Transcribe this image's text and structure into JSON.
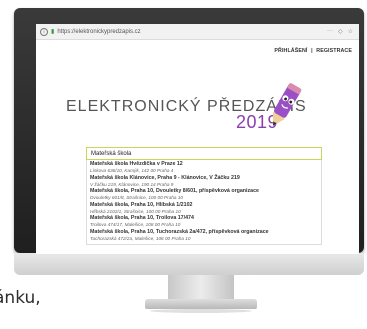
{
  "backdrop": {
    "caption": "ánku,"
  },
  "browser": {
    "url": "https://elektronickypredzapis.cz",
    "menu_glyph": "···",
    "shield_glyph": "◇",
    "star_glyph": "☆"
  },
  "header": {
    "login": "PŘIHLÁŠENÍ",
    "separator": "|",
    "register": "REGISTRACE"
  },
  "logo": {
    "text": "ELEKTRONICKÝ PŘEDZÁPIS",
    "year": "2019",
    "year_color": "#8a3fb0"
  },
  "search": {
    "value": "Mateřská škola"
  },
  "suggestions": [
    {
      "name": "Mateřská škola Hvězdička v Praze 12",
      "address": "Lískova 636/10, Kamýk, 142 00 Praha 4"
    },
    {
      "name": "Mateřská škola Klánovice, Praha 9 - Klánovice, V Žáčku 219",
      "address": "V žáčku 219, Klánovice, 190 14 Praha 9"
    },
    {
      "name": "Mateřská škola, Praha 10, Dvouletky 8/601, příspěvková organizace",
      "address": "Dvouletky 601/8, Strašnice, 100 00 Praha 10"
    },
    {
      "name": "Mateřská škola, Praha 10, Hlíbská 1/2102",
      "address": "Hlíbská 2102/1, Strašnice, 100 00 Praha 10"
    },
    {
      "name": "Mateřská škola, Praha 10, Troilova 17/474",
      "address": "Troilova 474/17, Malešice, 108 00 Praha 10"
    },
    {
      "name": "Mateřská škola, Praha 10, Tuchorazská 2a/472, příspěvková organizace",
      "address": "Tuchorazská 472/2a, Malešice, 108 00 Praha 10"
    }
  ]
}
